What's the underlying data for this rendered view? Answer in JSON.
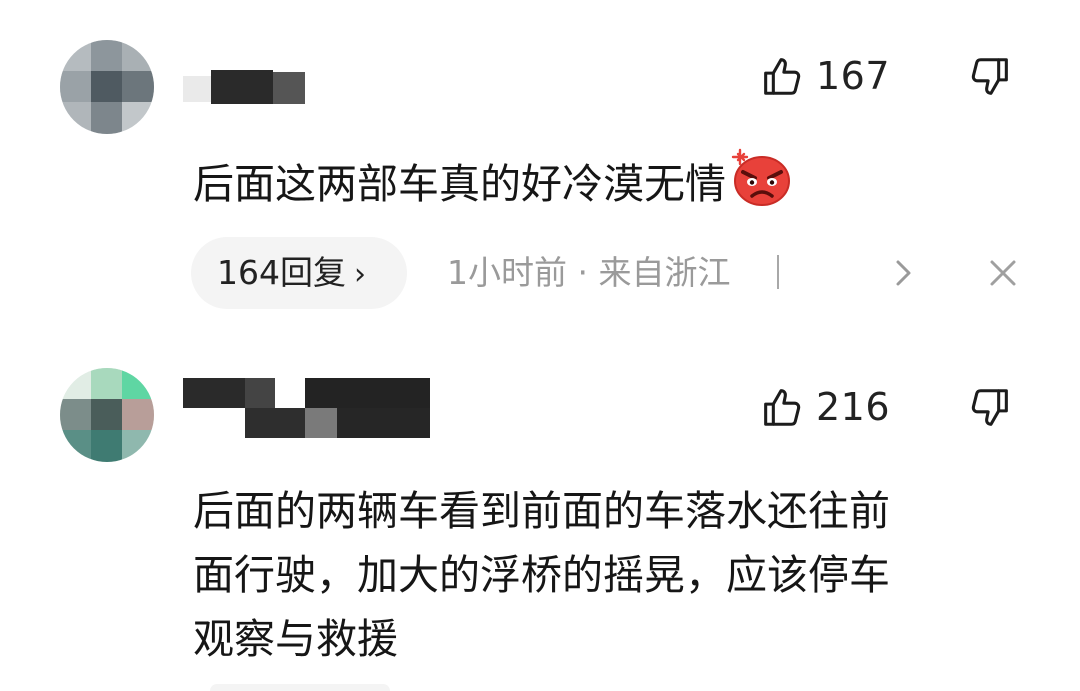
{
  "comments": [
    {
      "likes": "167",
      "text": "后面这两部车真的好冷漠无情",
      "emoji": "angry-face",
      "replies_label": "164回复",
      "replies_chevron": "›",
      "meta": "1小时前 · 来自浙江"
    },
    {
      "likes": "216",
      "text_lines": [
        "后面的两辆车看到前面的车落水还往前",
        "面行驶，加大的浮桥的摇晃，应该停车",
        "观察与救援"
      ]
    }
  ],
  "colors": {
    "text": "#161616",
    "meta": "#9a9a9a",
    "pill_bg": "#f4f4f4",
    "emoji_red": "#e8413a"
  },
  "icons": [
    "thumbs-up-icon",
    "thumbs-down-icon",
    "chevron-right-icon",
    "close-icon",
    "angry-emoji-icon"
  ]
}
